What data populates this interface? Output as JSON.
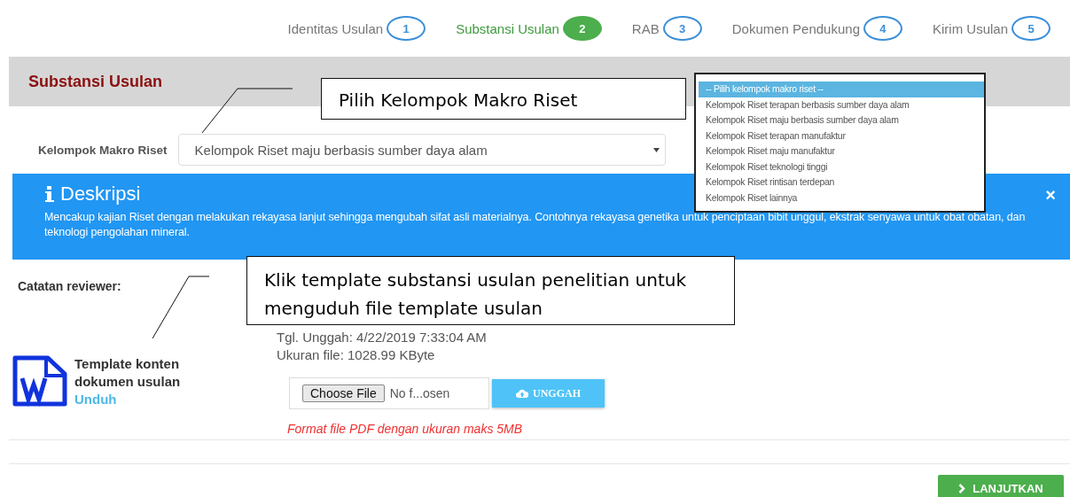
{
  "steps": [
    {
      "label": "Identitas Usulan",
      "number": "1",
      "selected": false
    },
    {
      "label": "Substansi Usulan",
      "number": "2",
      "selected": true
    },
    {
      "label": "RAB",
      "number": "3",
      "selected": false
    },
    {
      "label": "Dokumen Pendukung",
      "number": "4",
      "selected": false
    },
    {
      "label": "Kirim Usulan",
      "number": "5",
      "selected": false
    }
  ],
  "panel_title": "Substansi Usulan",
  "macro_field": {
    "label": "Kelompok Makro Riset",
    "value": "Kelompok Riset maju berbasis sumber daya alam"
  },
  "dropdown_options": [
    {
      "label": "-- Pilih kelompok makro riset --",
      "selected": true
    },
    {
      "label": "Kelompok Riset terapan berbasis sumber daya alam",
      "selected": false
    },
    {
      "label": "Kelompok Riset maju berbasis sumber daya alam",
      "selected": false
    },
    {
      "label": "Kelompok Riset terapan manufaktur",
      "selected": false
    },
    {
      "label": "Kelompok Riset maju manufaktur",
      "selected": false
    },
    {
      "label": "Kelompok Riset teknologi tinggi",
      "selected": false
    },
    {
      "label": "Kelompok Riset rintisan terdepan",
      "selected": false
    },
    {
      "label": "Kelompok Riset lainnya",
      "selected": false
    }
  ],
  "description": {
    "title": "Deskripsi",
    "close": "×",
    "text": "Mencakup kajian Riset dengan melakukan rekayasa lanjut sehingga mengubah sifat asli materialnya. Contohnya rekayasa genetika untuk penciptaan bibit unggul, ekstrak senyawa untuk obat obatan, dan teknologi pengolahan mineral."
  },
  "reviewer_label": "Catatan reviewer:",
  "template": {
    "title": "Template konten dokumen usulan",
    "link": "Unduh"
  },
  "file_info": [
    "Tgl. Unggah: 4/22/2019 7:33:04 AM",
    "Ukuran file: 1028.99 KByte"
  ],
  "file_input": {
    "button": "Choose File",
    "status": "No f...osen"
  },
  "upload_button": "UNGGAH",
  "format_note": "Format file PDF dengan ukuran maks 5MB",
  "next_button": "LANJUTKAN",
  "callouts": [
    "Pilih Kelompok Makro Riset",
    "Klik template substansi usulan penelitian untuk menguduh file template usulan"
  ]
}
